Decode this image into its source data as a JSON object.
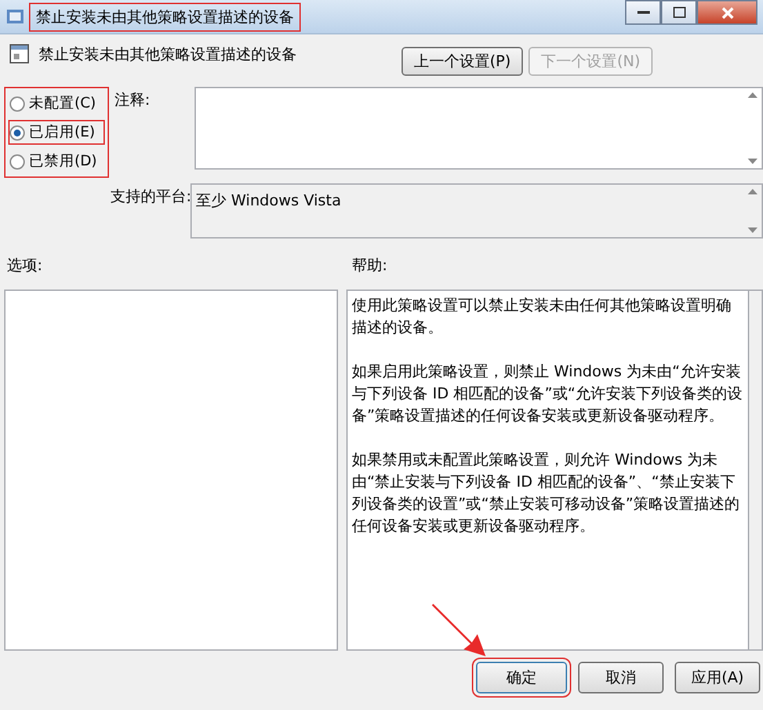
{
  "window": {
    "title": "禁止安装未由其他策略设置描述的设备"
  },
  "header": {
    "title": "禁止安装未由其他策略设置描述的设备",
    "buttons": [
      {
        "label": "上一个设置(P)",
        "disabled": false
      },
      {
        "label": "下一个设置(N)",
        "disabled": true
      }
    ]
  },
  "states": [
    {
      "label": "未配置(C)",
      "selected": false
    },
    {
      "label": "已启用(E)",
      "selected": true
    },
    {
      "label": "已禁用(D)",
      "selected": false
    }
  ],
  "comment": {
    "label": "注释:"
  },
  "platform": {
    "label": "支持的平台:",
    "value": "至少 Windows Vista"
  },
  "options": {
    "label": "选项:"
  },
  "help": {
    "label": "帮助:",
    "paragraphs": [
      "使用此策略设置可以禁止安装未由任何其他策略设置明确描述的设备。",
      "如果启用此策略设置，则禁止 Windows 为未由“允许安装与下列设备 ID 相匹配的设备”或“允许安装下列设备类的设备”策略设置描述的任何设备安装或更新设备驱动程序。",
      "如果禁用或未配置此策略设置，则允许 Windows 为未由“禁止安装与下列设备 ID 相匹配的设备”、“禁止安装下列设备类的设置”或“禁止安装可移动设备”策略设置描述的任何设备安装或更新设备驱动程序。"
    ]
  },
  "footer": {
    "buttons": [
      {
        "label": "确定",
        "highlighted": true
      },
      {
        "label": "取消",
        "highlighted": false
      },
      {
        "label": "应用(A)",
        "highlighted": false
      }
    ]
  }
}
